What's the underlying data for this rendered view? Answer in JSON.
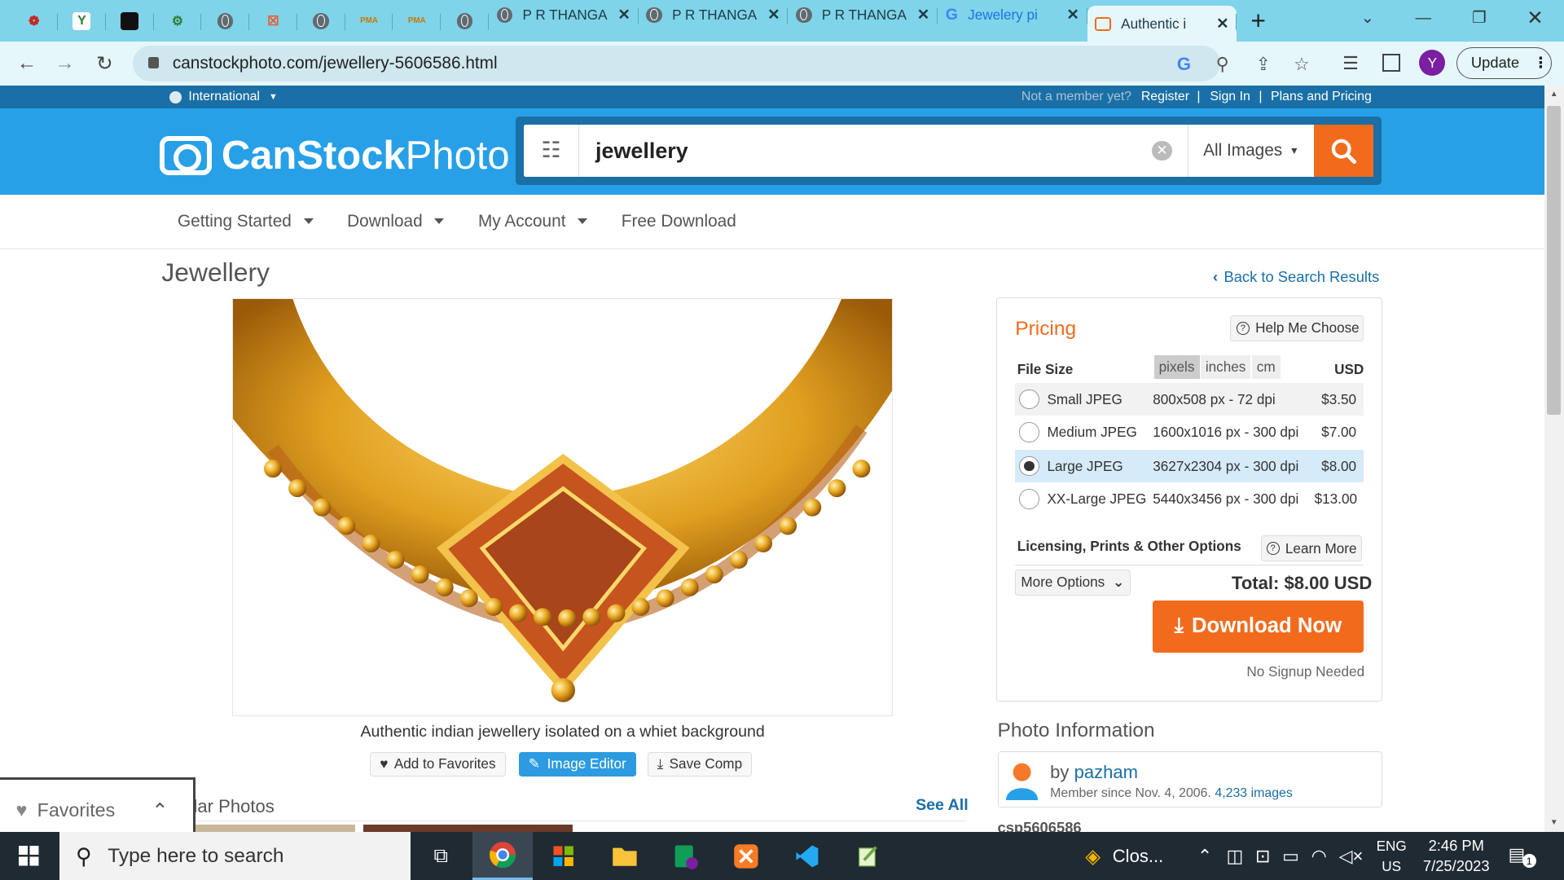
{
  "browser": {
    "tabs": [
      {
        "title": "P R THANGA",
        "kind": "globe"
      },
      {
        "title": "P R THANGA",
        "kind": "globe"
      },
      {
        "title": "P R THANGA",
        "kind": "globe"
      },
      {
        "title": "Jewelery pi",
        "kind": "google"
      },
      {
        "title": "Authentic i",
        "kind": "canstock",
        "active": true
      }
    ],
    "pinned_icons": [
      "site-icon-red",
      "site-icon-y",
      "site-icon-sha",
      "openai-icon",
      "globe-icon",
      "xampp-icon",
      "globe-icon",
      "pma-icon",
      "pma-icon",
      "globe-icon"
    ],
    "pinned_glyphs": [
      "❁",
      "Y",
      "sha",
      "⚙",
      "",
      "☒",
      "",
      "PMA",
      "PMA",
      ""
    ],
    "url": "canstockphoto.com/jewellery-5606586.html",
    "profile_initial": "Y",
    "update_label": "Update"
  },
  "site": {
    "region": "International",
    "not_member": "Not a member yet?",
    "register": "Register",
    "sign_in": "Sign In",
    "plans": "Plans and Pricing",
    "separator": "|",
    "logo_bold": "CanStock",
    "logo_light": "Photo",
    "search_query": "jewellery",
    "search_type": "All Images",
    "menu": [
      {
        "label": "Getting Started",
        "dropdown": true
      },
      {
        "label": "Download",
        "dropdown": true
      },
      {
        "label": "My Account",
        "dropdown": true
      },
      {
        "label": "Free Download",
        "dropdown": false
      }
    ]
  },
  "page": {
    "title": "Jewellery",
    "back_link": "Back to Search Results",
    "caption": "Authentic indian jewellery isolated on a whiet background",
    "actions": [
      "Add to Favorites",
      "Image Editor",
      "Save Comp"
    ],
    "similar_heading": "ilar Photos",
    "see_all": "See All"
  },
  "pricing": {
    "heading": "Pricing",
    "help": "Help Me Choose",
    "file_size_label": "File Size",
    "units": [
      "pixels",
      "inches",
      "cm"
    ],
    "selected_unit": "pixels",
    "currency": "USD",
    "rows": [
      {
        "name": "Small JPEG",
        "dims": "800x508 px - 72 dpi",
        "price": "$3.50"
      },
      {
        "name": "Medium JPEG",
        "dims": "1600x1016 px - 300 dpi",
        "price": "$7.00"
      },
      {
        "name": "Large JPEG",
        "dims": "3627x2304 px - 300 dpi",
        "price": "$8.00",
        "selected": true
      },
      {
        "name": "XX-Large JPEG",
        "dims": "5440x3456 px - 300 dpi",
        "price": "$13.00"
      }
    ],
    "licensing_label": "Licensing, Prints & Other Options",
    "learn_more": "Learn More",
    "more_options": "More Options",
    "total": "Total: $8.00 USD",
    "download": "Download Now",
    "no_signup": "No Signup Needed"
  },
  "photo_info": {
    "heading": "Photo Information",
    "by": "by",
    "author": "pazham",
    "member_since": "Member since Nov. 4, 2006.",
    "images": "4,233 images",
    "id": "csp5606586"
  },
  "favorites": {
    "label": "Favorites"
  },
  "taskbar": {
    "search_placeholder": "Type here to search",
    "weather": "Clos...",
    "lang1": "ENG",
    "lang2": "US",
    "time": "2:46 PM",
    "date": "7/25/2023",
    "notif_count": "1"
  },
  "colors": {
    "brand_blue": "#27a0e8",
    "dark_blue": "#1a6fa6",
    "orange": "#f26b1d"
  }
}
